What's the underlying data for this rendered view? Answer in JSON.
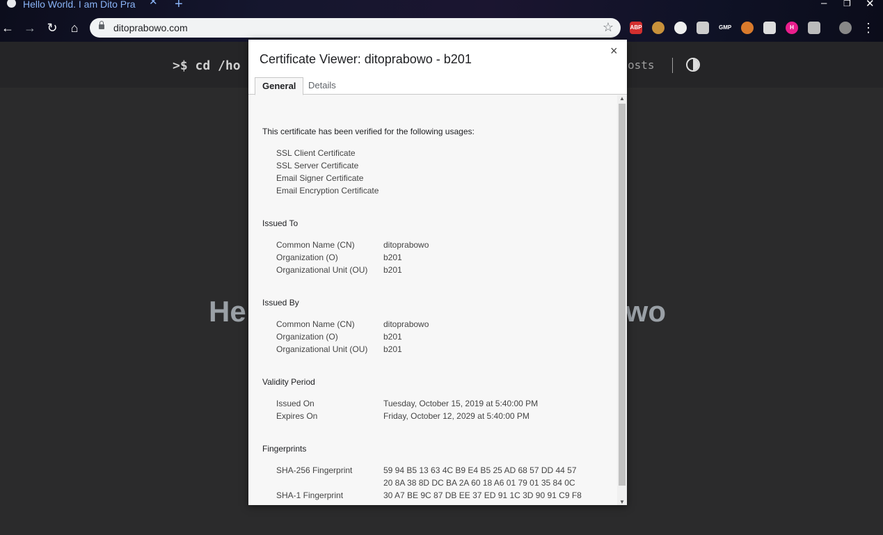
{
  "browser": {
    "tab_title": "Hello World. I am Dito Pra",
    "url": "ditoprabowo.com",
    "extensions": [
      "ABP",
      "GMP",
      "H"
    ]
  },
  "page": {
    "prompt": ">$ cd /ho",
    "nav_link": "osts",
    "hero_left": "He",
    "hero_right": "wo"
  },
  "dialog": {
    "title": "Certificate Viewer: ditoprabowo - b201",
    "close": "×",
    "tabs": [
      "General",
      "Details"
    ],
    "verified_text": "This certificate has been verified for the following usages:",
    "usages": [
      "SSL Client Certificate",
      "SSL Server Certificate",
      "Email Signer Certificate",
      "Email Encryption Certificate"
    ],
    "issued_to": {
      "title": "Issued To",
      "rows": [
        {
          "label": "Common Name (CN)",
          "value": "ditoprabowo"
        },
        {
          "label": "Organization (O)",
          "value": "b201"
        },
        {
          "label": "Organizational Unit (OU)",
          "value": "b201"
        }
      ]
    },
    "issued_by": {
      "title": "Issued By",
      "rows": [
        {
          "label": "Common Name (CN)",
          "value": "ditoprabowo"
        },
        {
          "label": "Organization (O)",
          "value": "b201"
        },
        {
          "label": "Organizational Unit (OU)",
          "value": "b201"
        }
      ]
    },
    "validity": {
      "title": "Validity Period",
      "rows": [
        {
          "label": "Issued On",
          "value": "Tuesday, October 15, 2019 at 5:40:00 PM"
        },
        {
          "label": "Expires On",
          "value": "Friday, October 12, 2029 at 5:40:00 PM"
        }
      ]
    },
    "fingerprints": {
      "title": "Fingerprints",
      "sha256_label": "SHA-256 Fingerprint",
      "sha256_line1": "59 94 B5 13 63 4C B9 E4 B5 25 AD 68 57 DD 44 57",
      "sha256_line2": "20 8A 38 8D DC BA 2A 60 18 A6 01 79 01 35 84 0C",
      "sha1_label": "SHA-1 Fingerprint",
      "sha1_line1": "30 A7 BE 9C 87 DB EE 37 ED 91 1C 3D 90 91 C9 F8"
    }
  }
}
